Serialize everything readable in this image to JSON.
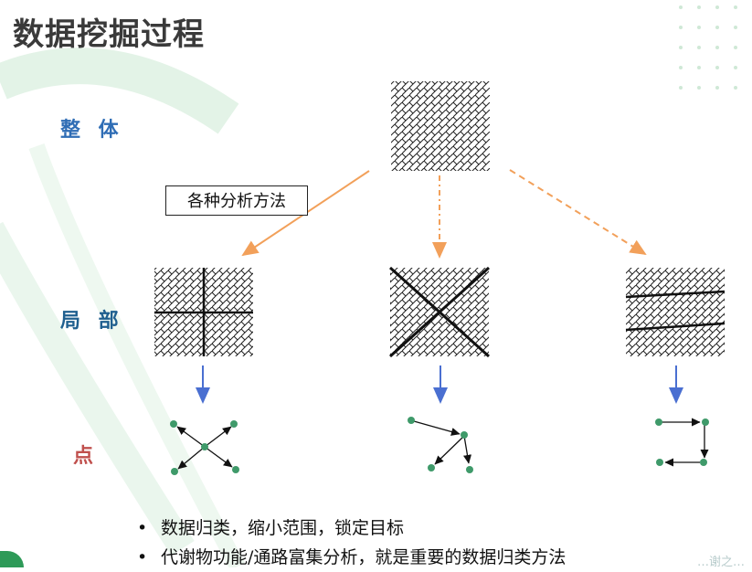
{
  "title": "数据挖掘过程",
  "levels": {
    "whole": "整 体",
    "local": "局 部",
    "point": "点"
  },
  "method_label": "各种分析方法",
  "bullets": [
    {
      "marker": "•",
      "text": "数据归类，缩小范围，锁定目标"
    },
    {
      "marker": "•",
      "text": "代谢物功能/通路富集分析，就是重要的数据归类方法"
    }
  ],
  "watermark": "…谢之…",
  "colors": {
    "whole_label": "#2f6db5",
    "local_label": "#1f5f8f",
    "point_label": "#c0504d",
    "method_arrow": "#f2a05a",
    "down_arrow": "#4a6fd1",
    "node": "#3f9a6a",
    "decor_green": "#dff1e4"
  }
}
